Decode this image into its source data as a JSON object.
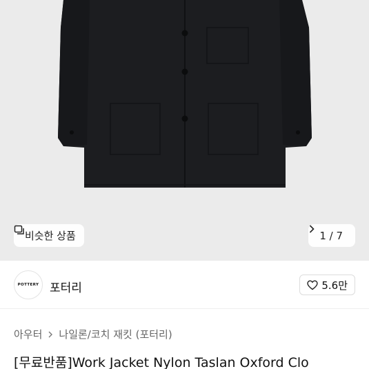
{
  "gallery": {
    "similar_label": "비슷한 상품",
    "counter": "1 / 7",
    "icons": {
      "similar": "similar-items-icon",
      "next": "chevron-right-icon"
    }
  },
  "seller": {
    "logo_text": "POTTERY",
    "name": "포터리",
    "likes": "5.6만",
    "like_icon": "heart-icon"
  },
  "breadcrumb": {
    "items": [
      "아우터",
      "나일론/코치 재킷 (포터리)"
    ],
    "separator_icon": "chevron-right-icon"
  },
  "product": {
    "title": "[무료반품]Work Jacket Nylon Taslan Oxford Clo"
  },
  "colors": {
    "hero_bg": "#ebebeb",
    "jacket": "#1c1d20"
  }
}
